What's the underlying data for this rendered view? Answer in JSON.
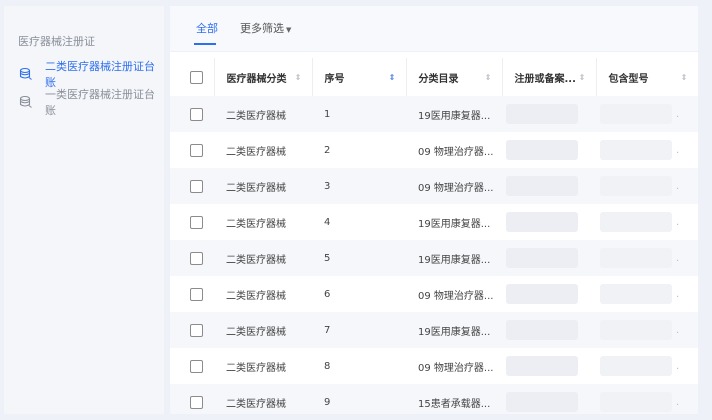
{
  "sidebar": {
    "title": "医疗器械注册证",
    "items": [
      {
        "label": "二类医疗器械注册证台账",
        "active": true
      },
      {
        "label": "一类医疗器械注册证台账",
        "active": false
      }
    ]
  },
  "tabs": {
    "all": "全部",
    "more": "更多筛选"
  },
  "table": {
    "headers": {
      "category": "医疗器械分类",
      "seq": "序号",
      "directory": "分类目录",
      "registration": "注册或备案...",
      "model": "包含型号"
    },
    "rows": [
      {
        "category": "二类医疗器械",
        "seq": "1",
        "directory": "19医用康复器..."
      },
      {
        "category": "二类医疗器械",
        "seq": "2",
        "directory": "09 物理治疗器..."
      },
      {
        "category": "二类医疗器械",
        "seq": "3",
        "directory": "09 物理治疗器..."
      },
      {
        "category": "二类医疗器械",
        "seq": "4",
        "directory": "19医用康复器..."
      },
      {
        "category": "二类医疗器械",
        "seq": "5",
        "directory": "19医用康复器..."
      },
      {
        "category": "二类医疗器械",
        "seq": "6",
        "directory": "09 物理治疗器..."
      },
      {
        "category": "二类医疗器械",
        "seq": "7",
        "directory": "19医用康复器..."
      },
      {
        "category": "二类医疗器械",
        "seq": "8",
        "directory": "09 物理治疗器..."
      },
      {
        "category": "二类医疗器械",
        "seq": "9",
        "directory": "15患者承载器..."
      }
    ]
  },
  "colors": {
    "accent": "#2f6fed",
    "sidebar_bg": "#f4f6fa",
    "row_alt": "#f5f7fa"
  }
}
